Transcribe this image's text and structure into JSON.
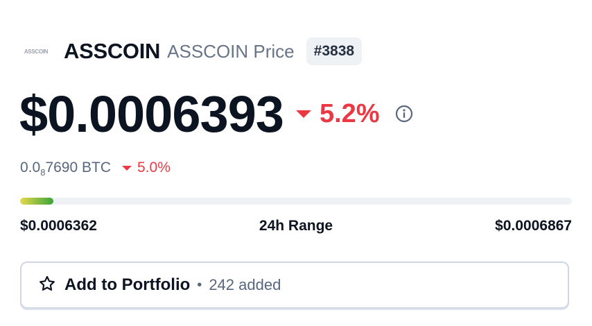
{
  "coin": {
    "logo_text": "ASSCOIN",
    "name": "ASSCOIN",
    "subtitle": "ASSCOIN Price",
    "rank": "#3838"
  },
  "price": {
    "value": "$0.0006393",
    "change_24h": "5.2%",
    "change_direction": "down",
    "info_icon": "info-circle-icon"
  },
  "btc": {
    "prefix": "0.0",
    "subscript_zeros": "8",
    "digits": "7690",
    "unit": "BTC",
    "change": "5.0%",
    "change_direction": "down"
  },
  "range": {
    "low": "$0.0006362",
    "label": "24h Range",
    "high": "$0.0006867",
    "position_fraction": 0.06
  },
  "portfolio": {
    "icon": "star-outline-icon",
    "label": "Add to Portfolio",
    "separator": "•",
    "added_text": "242 added"
  },
  "colors": {
    "negative": "#ea3943",
    "text_primary": "#0d1421",
    "text_secondary": "#58667e",
    "range_gradient_start": "#e6d94a",
    "range_gradient_end": "#3aa43a"
  }
}
